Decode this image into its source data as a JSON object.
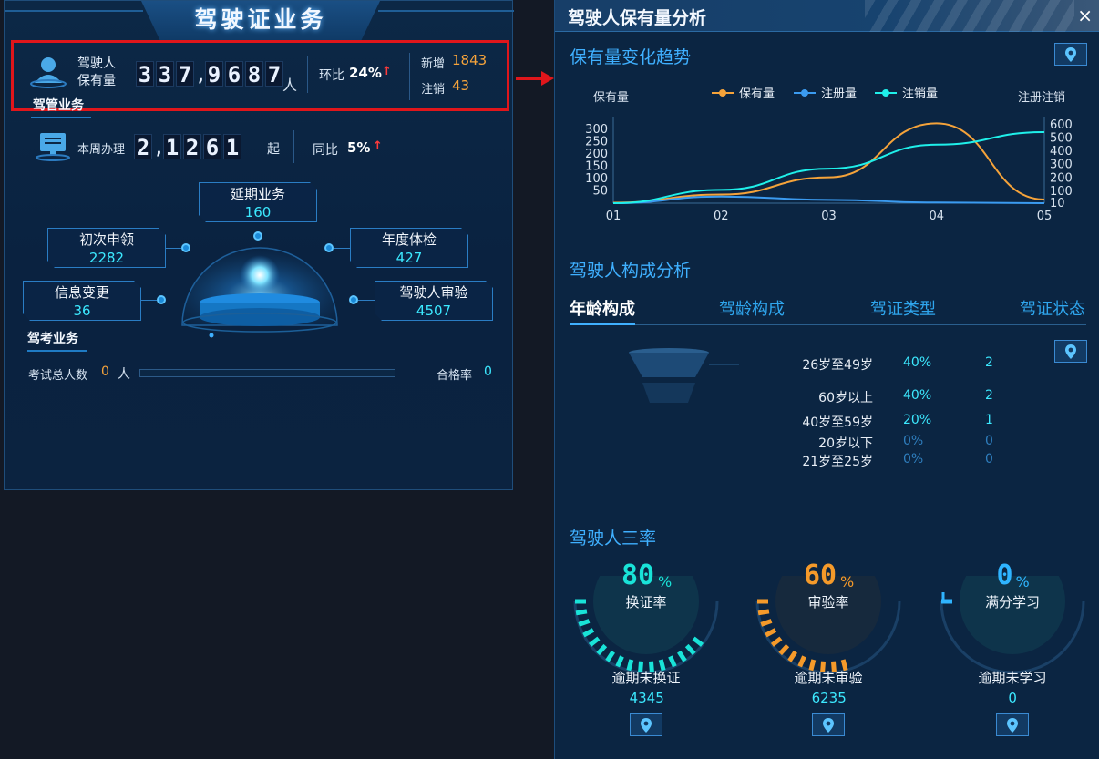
{
  "left": {
    "title": "驾驶证业务",
    "holding": {
      "label_line1": "驾驶人",
      "label_line2": "保有量",
      "digits": [
        "3",
        "3",
        "7",
        ",",
        "9",
        "6",
        "8",
        "7"
      ],
      "unit": "人",
      "hb_label": "环比",
      "hb_value": "24%",
      "new_label": "新增",
      "new_value": "1843",
      "cancel_label": "注销",
      "cancel_value": "43"
    },
    "section_manage": "驾管业务",
    "week": {
      "label": "本周办理",
      "digits": [
        "2",
        ",",
        "1",
        "2",
        "6",
        "1"
      ],
      "unit": "起",
      "tb_label": "同比",
      "tb_value": "5%"
    },
    "nodes": {
      "delay": {
        "label": "延期业务",
        "value": "160"
      },
      "first": {
        "label": "初次申领",
        "value": "2282"
      },
      "annual": {
        "label": "年度体检",
        "value": "427"
      },
      "info": {
        "label": "信息变更",
        "value": "36"
      },
      "audit": {
        "label": "驾驶人审验",
        "value": "4507"
      }
    },
    "section_exam": "驾考业务",
    "exam": {
      "total_label": "考试总人数",
      "total_value": "0",
      "total_unit": "人",
      "progress": 0,
      "pass_label": "合格率",
      "pass_value": "0"
    }
  },
  "right": {
    "title": "驾驶人保有量分析",
    "close": "×",
    "trend": {
      "section": "保有量变化趋势",
      "ylabel_left": "保有量",
      "ylabel_right": "注册注销"
    },
    "composition": {
      "section": "驾驶人构成分析",
      "tabs": [
        "年龄构成",
        "驾龄构成",
        "驾证类型",
        "驾证状态"
      ],
      "active_tab": 0,
      "rows": [
        {
          "label": "26岁至49岁",
          "pct": "40%",
          "count": "2"
        },
        {
          "label": "60岁以上",
          "pct": "40%",
          "count": "2"
        },
        {
          "label": "40岁至59岁",
          "pct": "20%",
          "count": "1"
        },
        {
          "label": "20岁以下",
          "pct": "0%",
          "count": "0"
        },
        {
          "label": "21岁至25岁",
          "pct": "0%",
          "count": "0"
        }
      ]
    },
    "rates": {
      "section": "驾驶人三率",
      "items": [
        {
          "value": "80",
          "pct": "%",
          "label": "换证率",
          "sub": "逾期未换证",
          "sub_value": "4345",
          "color": "#19e3d8",
          "fraction": 0.8
        },
        {
          "value": "60",
          "pct": "%",
          "label": "审验率",
          "sub": "逾期未审验",
          "sub_value": "6235",
          "color": "#f59a2a",
          "fraction": 0.6
        },
        {
          "value": "0",
          "pct": "%",
          "label": "满分学习",
          "sub": "逾期未学习",
          "sub_value": "0",
          "color": "#2fb4ff",
          "fraction": 0.0
        }
      ]
    }
  },
  "chart_data": {
    "type": "line",
    "categories": [
      "01",
      "02",
      "03",
      "04",
      "05"
    ],
    "ylabel": "保有量",
    "ylabel_right": "注册注销",
    "yticks_left": [
      50,
      100,
      150,
      200,
      250,
      300
    ],
    "yticks_right": [
      10,
      100,
      200,
      300,
      400,
      500,
      600
    ],
    "ylim_left": [
      0,
      330
    ],
    "ylim_right": [
      10,
      620
    ],
    "legend_position": "top",
    "series": [
      {
        "name": "保有量",
        "axis": "left",
        "color": "#f5a33a",
        "values": [
          2,
          35,
          105,
          325,
          15
        ]
      },
      {
        "name": "注册量",
        "axis": "right",
        "color": "#3b9bf0",
        "values": [
          10,
          60,
          35,
          15,
          10
        ]
      },
      {
        "name": "注销量",
        "axis": "right",
        "color": "#1ff0ea",
        "values": [
          10,
          110,
          270,
          450,
          545
        ]
      }
    ]
  },
  "colors": {
    "accent": "#3fb0ff",
    "cyan": "#3ce9ff",
    "orange": "#f7a43b",
    "red": "#e0161b"
  }
}
